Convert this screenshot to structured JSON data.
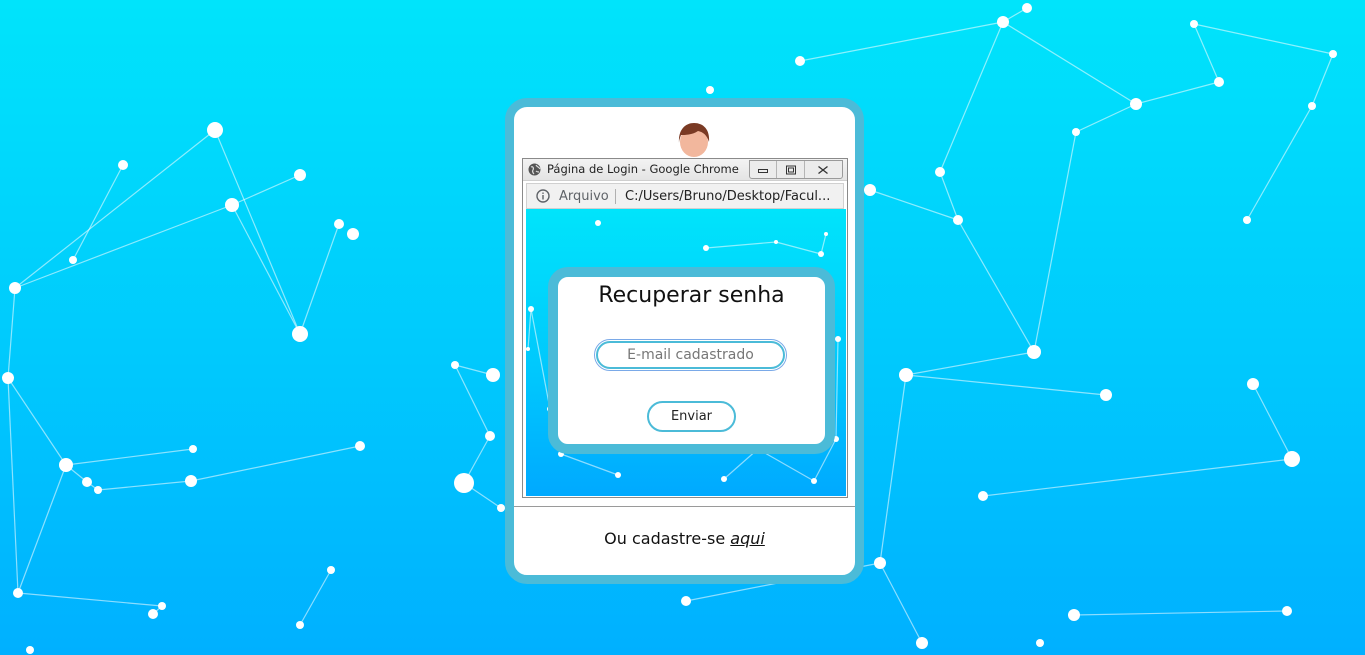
{
  "browser": {
    "window_title": "Página de Login - Google Chrome",
    "address_scheme": "Arquivo",
    "address_url": "C:/Users/Bruno/Desktop/Facul...",
    "icons": {
      "globe": "globe-icon",
      "info": "info-icon",
      "minimize": "minimize-icon",
      "maximize": "maximize-icon",
      "close": "close-icon"
    }
  },
  "recover": {
    "title": "Recuperar senha",
    "email_placeholder": "E-mail cadastrado",
    "email_value": "",
    "submit_label": "Enviar"
  },
  "footer": {
    "register_prefix": "Ou cadastre-se",
    "register_link": "aqui"
  },
  "colors": {
    "background_top": "#00e4fb",
    "background_bottom": "#00b0ff",
    "card_border": "#4bbbd8"
  }
}
